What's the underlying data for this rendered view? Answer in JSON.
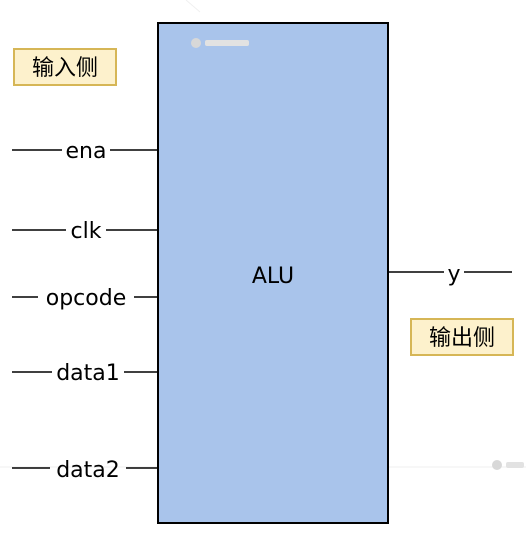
{
  "colors": {
    "alu_fill": "#a9c4eb",
    "alu_border": "#000000",
    "note_fill": "#fdf1cc",
    "note_border": "#d6b656"
  },
  "input_side_label": "输入侧",
  "output_side_label": "输出侧",
  "alu_label": "ALU",
  "inputs": [
    "ena",
    "clk",
    "opcode",
    "data1",
    "data2"
  ],
  "output": "y"
}
